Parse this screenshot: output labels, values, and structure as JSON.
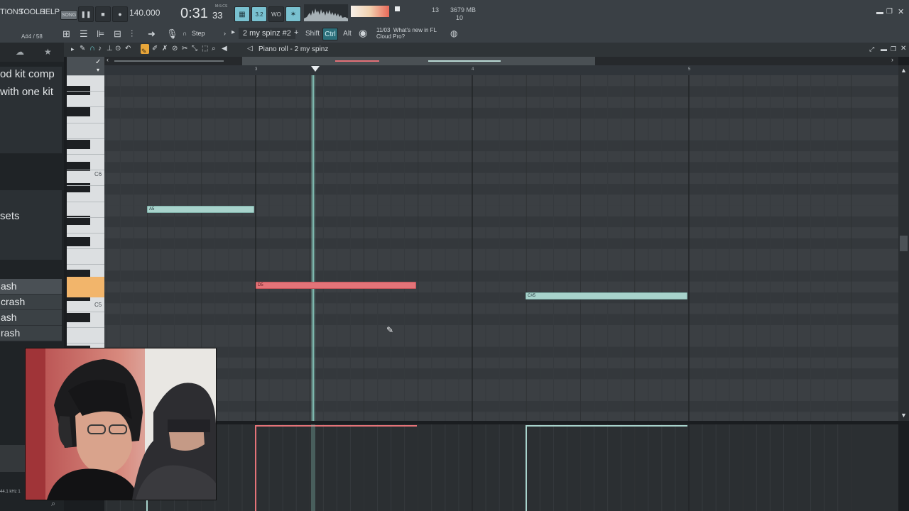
{
  "menu": {
    "tions": "TIONS",
    "tools": "TOOLS",
    "help": "HELP"
  },
  "transport": {
    "song_label": "SONG",
    "tempo": "140.000",
    "time_main": "0:31",
    "time_sub": "33",
    "time_unit": "M:S:CS"
  },
  "status": {
    "num1": "13",
    "num2": "10",
    "memory": "3679 MB"
  },
  "hint": {
    "pos": "A#4 / 58"
  },
  "tools": {
    "snap": "Step",
    "pattern": "2 my spinz #2",
    "shift": "Shift",
    "ctrl": "Ctrl",
    "alt": "Alt",
    "news_date": "11/03",
    "news_title": "What's new in FL",
    "news_sub": "Cloud Pro?"
  },
  "pianoroll": {
    "title": "Piano roll - 2 my spinz",
    "bar3": "3",
    "bar4": "4",
    "bar5": "5"
  },
  "browser": {
    "line1": "od kit comp",
    "line2": "with one kit",
    "line3": "sets",
    "items": [
      "ash",
      "crash",
      "ash",
      "rash"
    ],
    "samplerate": "44.1 kHz 1"
  },
  "keys": {
    "c6": "C6",
    "c5": "C5"
  },
  "notes": [
    {
      "label": "A5",
      "color": "#a8d3cc"
    },
    {
      "label": "D5",
      "color": "#e47378"
    },
    {
      "label": "C#5",
      "color": "#a8d3cc"
    }
  ],
  "colors": {
    "note_teal": "#a8d3cc",
    "note_red": "#e47378",
    "playhead": "#7db7ad",
    "accent_key": "#f2b56b"
  }
}
